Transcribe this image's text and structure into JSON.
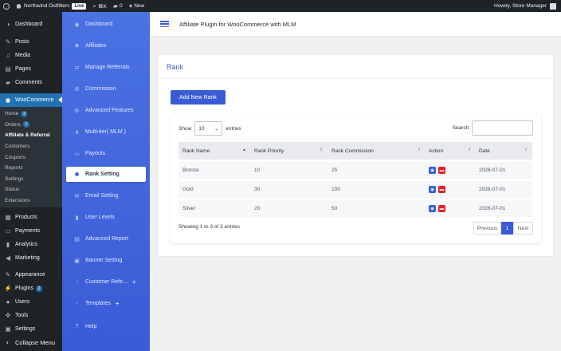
{
  "admin_bar": {
    "site_name": "Northwind Outfitters",
    "live_badge": "Live",
    "search_shortcut": "⌘K",
    "comments_count": "0",
    "new_label": "New",
    "howdy": "Howdy, Store Manager"
  },
  "wp_menu": {
    "dashboard": "Dashboard",
    "posts": "Posts",
    "media": "Media",
    "pages": "Pages",
    "comments": "Comments",
    "woocommerce": "WooCommerce",
    "sub": {
      "home": "Home",
      "home_badge": "3",
      "orders": "Orders",
      "orders_badge": "1",
      "affiliate": "Affiliate & Referral",
      "customers": "Customers",
      "coupons": "Coupons",
      "reports": "Reports",
      "settings": "Settings",
      "status": "Status",
      "extensions": "Extensions"
    },
    "products": "Products",
    "payments": "Payments",
    "analytics": "Analytics",
    "marketing": "Marketing",
    "appearance": "Appearance",
    "plugins": "Plugins",
    "plugins_badge": "2",
    "users": "Users",
    "tools": "Tools",
    "settings": "Settings",
    "collapse": "Collapse Menu"
  },
  "plugin_sidebar": [
    {
      "label": "Dashboard",
      "icon": "eye-icon"
    },
    {
      "label": "Affiliates",
      "icon": "users-icon"
    },
    {
      "label": "Manage Referrals",
      "icon": "referral-icon"
    },
    {
      "label": "Commission",
      "icon": "gear-icon"
    },
    {
      "label": "Advanced Features",
      "icon": "gear-icon"
    },
    {
      "label": "Multi-tier( MLM )",
      "icon": "tree-icon"
    },
    {
      "label": "Payouts",
      "icon": "card-icon"
    },
    {
      "label": "Rank Setting",
      "icon": "settings-icon"
    },
    {
      "label": "Email Setting",
      "icon": "mail-icon"
    },
    {
      "label": "User Levels",
      "icon": "bars-icon"
    },
    {
      "label": "Advanced Report",
      "icon": "report-icon"
    },
    {
      "label": "Banner Setting",
      "icon": "image-icon"
    },
    {
      "label": "Customer Refe...",
      "icon": "chevron-icon"
    },
    {
      "label": "Templates",
      "icon": "chevron-icon"
    },
    {
      "label": "Help",
      "icon": "help-icon"
    }
  ],
  "header": {
    "title": "Affiliate Plugin for WooCommerce with MLM"
  },
  "rank_card": {
    "title": "Rank",
    "add_button": "Add New Rank"
  },
  "table": {
    "show_label": "Show",
    "page_size": "10",
    "entries_label": "entries",
    "search_label": "Search:",
    "columns": [
      "Rank Name",
      "Rank Priority",
      "Rank Commission",
      "Action",
      "Date"
    ],
    "rows": [
      {
        "name": "Bronze",
        "priority": "10",
        "commission": "25",
        "date": "2026-07-01"
      },
      {
        "name": "Gold",
        "priority": "30",
        "commission": "100",
        "date": "2026-07-01"
      },
      {
        "name": "Silver",
        "priority": "20",
        "commission": "50",
        "date": "2026-07-01"
      }
    ],
    "info": "Showing 1 to 3 of 3 entries",
    "pager": {
      "previous": "Previous",
      "page": "1",
      "next": "Next"
    }
  },
  "colors": {
    "accent": "#3a5bd6",
    "delete": "#e61e28",
    "wp_dark": "#1d2327",
    "wp_blue": "#2271b1"
  }
}
